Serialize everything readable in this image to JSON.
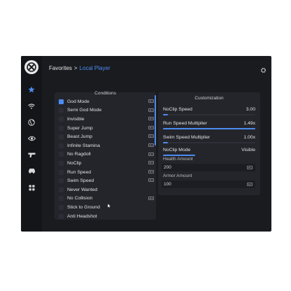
{
  "header": {
    "breadcrumb_root": "Favorites",
    "separator": ">",
    "breadcrumb_current": "Local Player"
  },
  "sidebar": {
    "items": [
      {
        "icon": "star-icon",
        "active": true
      },
      {
        "icon": "wifi-icon",
        "active": false
      },
      {
        "icon": "globe-icon",
        "active": false
      },
      {
        "icon": "eye-icon",
        "active": false
      },
      {
        "icon": "gun-icon",
        "active": false
      },
      {
        "icon": "car-icon",
        "active": false
      },
      {
        "icon": "grid-icon",
        "active": false
      }
    ]
  },
  "conditions": {
    "title": "Conditions",
    "items": [
      {
        "label": "God Mode",
        "checked": true,
        "keybind": true
      },
      {
        "label": "Semi God Mode",
        "checked": false,
        "keybind": true
      },
      {
        "label": "Invisible",
        "checked": false,
        "keybind": true
      },
      {
        "label": "Super Jump",
        "checked": false,
        "keybind": true
      },
      {
        "label": "Beast Jump",
        "checked": false,
        "keybind": true
      },
      {
        "label": "Infinite Stamina",
        "checked": false,
        "keybind": true
      },
      {
        "label": "No Ragdoll",
        "checked": false,
        "keybind": true
      },
      {
        "label": "NoClip",
        "checked": false,
        "keybind": true
      },
      {
        "label": "Run Speed",
        "checked": false,
        "keybind": true
      },
      {
        "label": "Swim Speed",
        "checked": false,
        "keybind": true
      },
      {
        "label": "Never Wanted",
        "checked": false,
        "keybind": false
      },
      {
        "label": "No Collision",
        "checked": false,
        "keybind": true
      },
      {
        "label": "Stick to Ground",
        "checked": false,
        "keybind": false
      },
      {
        "label": "Anti Headshot",
        "checked": false,
        "keybind": false
      }
    ]
  },
  "customization": {
    "title": "Customization",
    "sliders": [
      {
        "label": "NoClip Speed",
        "value": "3.00",
        "fraction": 0.05
      },
      {
        "label": "Run Speed Multiplier",
        "value": "1.49x",
        "fraction": 1.0
      },
      {
        "label": "Swim Speed Multiplier",
        "value": "1.00x",
        "fraction": 0.05
      }
    ],
    "mode": {
      "label": "NoClip Mode",
      "value": "Visible",
      "fraction": 0.35
    },
    "health": {
      "label": "Health Amount",
      "value": "200"
    },
    "armor": {
      "label": "Armor Amount",
      "value": "100"
    }
  },
  "colors": {
    "accent": "#4b8cf0",
    "background": "#1a1b1f",
    "panel": "#24252b"
  }
}
